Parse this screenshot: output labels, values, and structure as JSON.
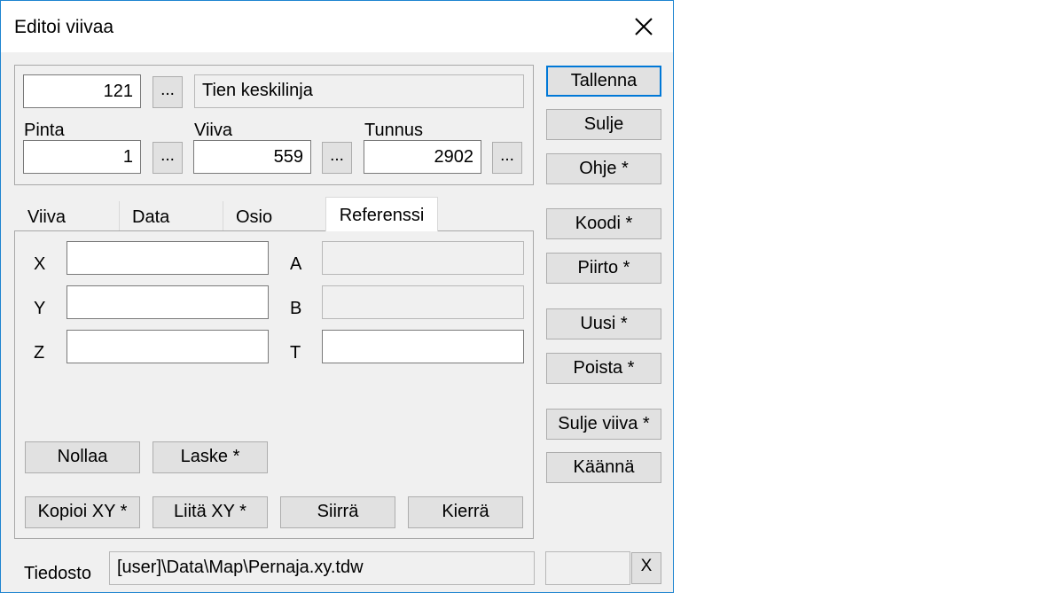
{
  "window": {
    "title": "Editoi viivaa"
  },
  "header": {
    "code_value": "121",
    "browse_label": "...",
    "code_description": "Tien keskilinja",
    "pinta_label": "Pinta",
    "pinta_value": "1",
    "viiva_label": "Viiva",
    "viiva_value": "559",
    "tunnus_label": "Tunnus",
    "tunnus_value": "2902"
  },
  "tabs": [
    {
      "label": "Viiva"
    },
    {
      "label": "Data"
    },
    {
      "label": "Osio"
    },
    {
      "label": "Referenssi"
    }
  ],
  "active_tab": "Referenssi",
  "reference": {
    "x_label": "X",
    "x_value": "",
    "y_label": "Y",
    "y_value": "",
    "z_label": "Z",
    "z_value": "",
    "a_label": "A",
    "a_value": "",
    "b_label": "B",
    "b_value": "",
    "t_label": "T",
    "t_value": "",
    "reset_label": "Nollaa",
    "compute_label": "Laske *",
    "copy_xy_label": "Kopioi XY *",
    "paste_xy_label": "Liitä XY *",
    "move_label": "Siirrä",
    "rotate_label": "Kierrä"
  },
  "side_buttons": {
    "save": "Tallenna",
    "close": "Sulje",
    "help": "Ohje *",
    "code": "Koodi *",
    "draw": "Piirto *",
    "new": "Uusi *",
    "delete": "Poista *",
    "close_line": "Sulje viiva *",
    "reverse": "Käännä"
  },
  "footer": {
    "file_label": "Tiedosto",
    "file_path": "[user]\\Data\\Map\\Pernaja.xy.tdw",
    "extra_value": "",
    "clear_label": "X"
  }
}
